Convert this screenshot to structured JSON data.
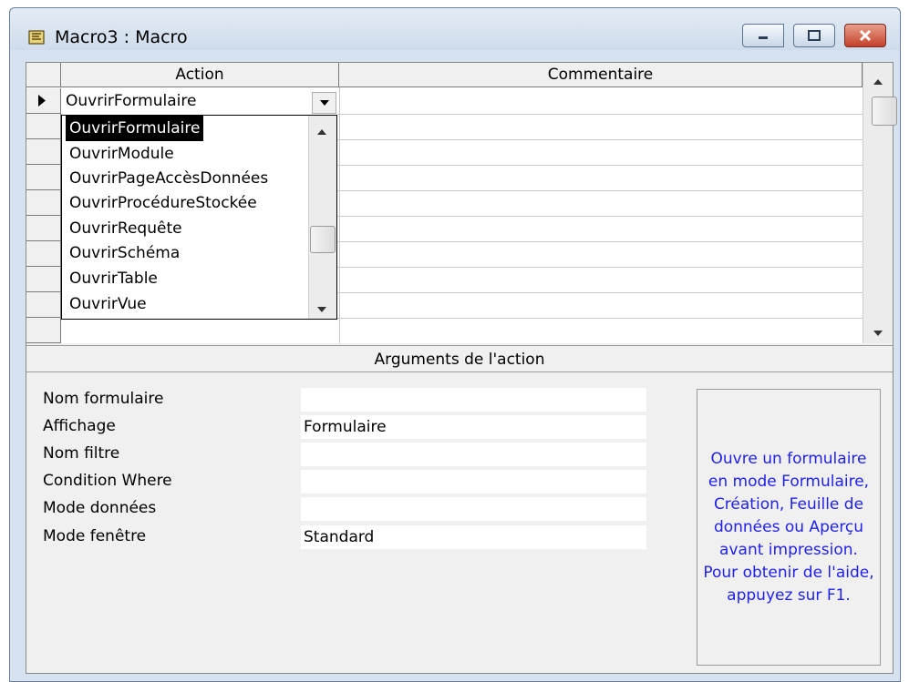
{
  "window": {
    "title": "Macro3 : Macro",
    "icon": "macro-icon",
    "buttons": {
      "minimize": "minimize-icon",
      "maximize": "maximize-icon",
      "close": "close-icon"
    }
  },
  "grid": {
    "columns": {
      "action": "Action",
      "comment": "Commentaire"
    },
    "current_action": "OuvrirFormulaire",
    "current_row_indicator": "record-pointer-icon"
  },
  "dropdown": {
    "selected": "OuvrirFormulaire",
    "items": [
      "OuvrirFormulaire",
      "OuvrirModule",
      "OuvrirPageAccèsDonnées",
      "OuvrirProcédureStockée",
      "OuvrirRequête",
      "OuvrirSchéma",
      "OuvrirTable",
      "OuvrirVue"
    ]
  },
  "arguments": {
    "title": "Arguments de l'action",
    "fields": [
      {
        "label": "Nom formulaire",
        "value": ""
      },
      {
        "label": "Affichage",
        "value": "Formulaire"
      },
      {
        "label": "Nom filtre",
        "value": ""
      },
      {
        "label": "Condition Where",
        "value": ""
      },
      {
        "label": "Mode données",
        "value": ""
      },
      {
        "label": "Mode fenêtre",
        "value": "Standard"
      }
    ],
    "help": "Ouvre un formulaire en mode Formulaire, Création, Feuille de données ou Aperçu avant impression. Pour obtenir de l'aide, appuyez sur F1."
  },
  "colors": {
    "help_text": "#1f1ff0",
    "selection": "#000000",
    "frame": "#d6e2ef"
  }
}
